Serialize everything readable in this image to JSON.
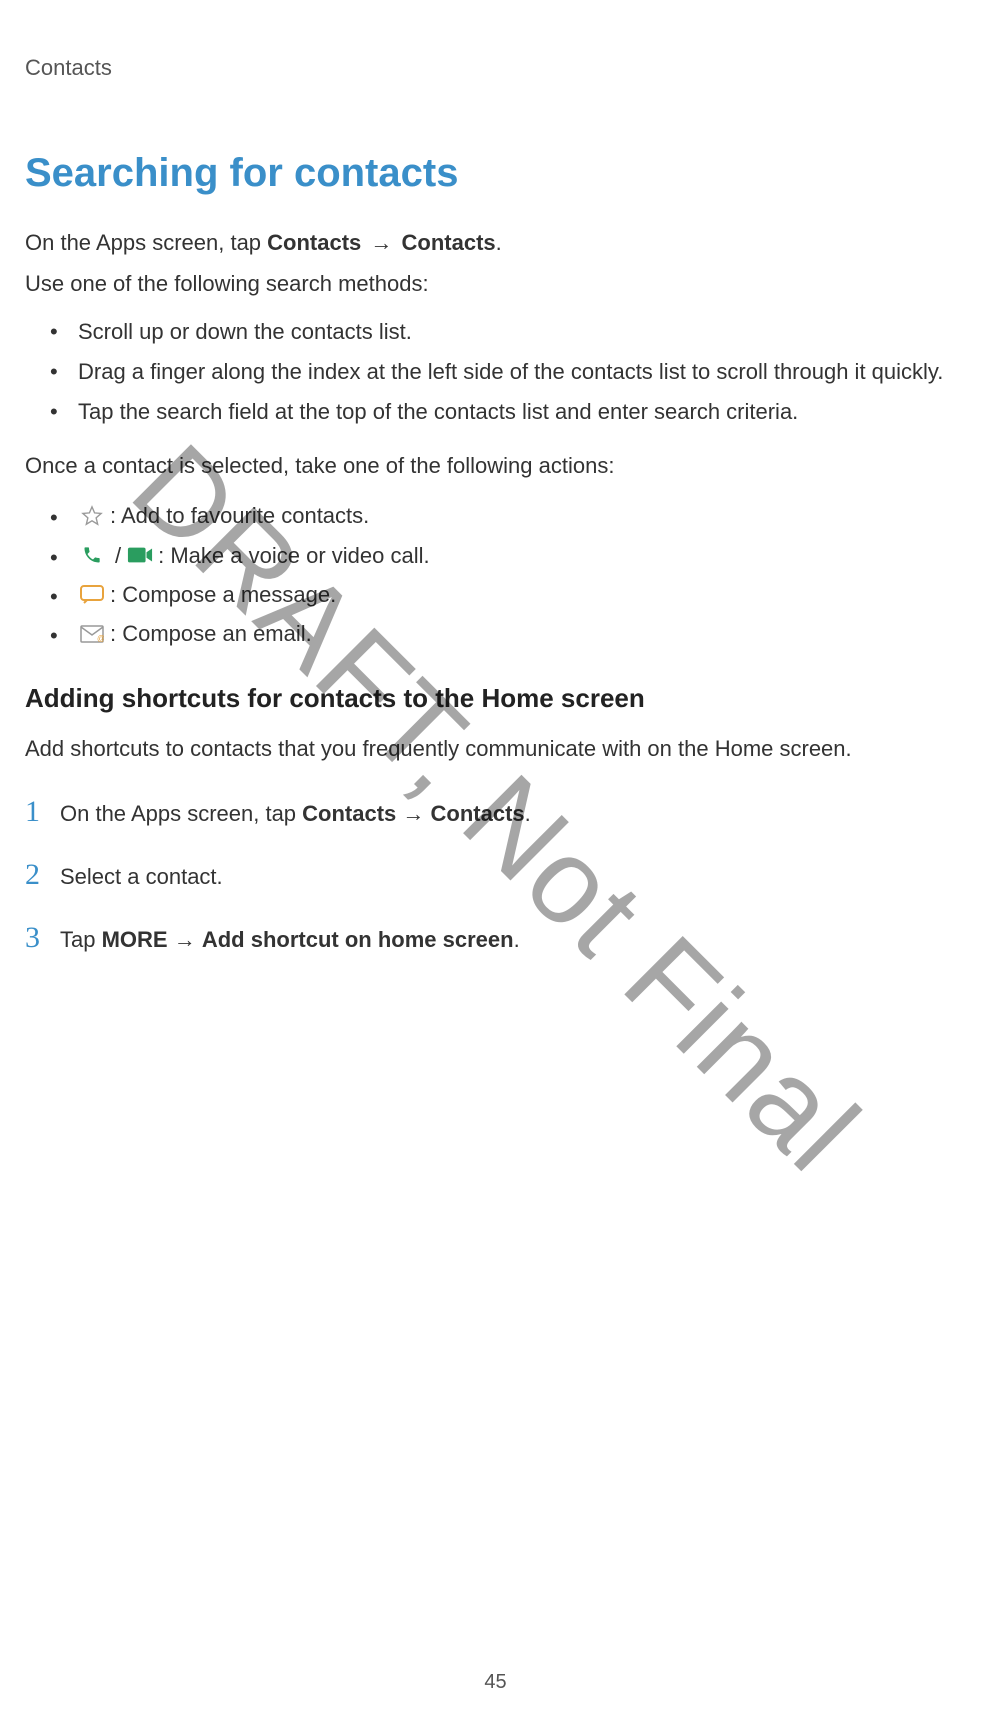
{
  "header": {
    "section": "Contacts"
  },
  "heading": "Searching for contacts",
  "intro1_pre": "On the Apps screen, tap ",
  "intro1_b1": "Contacts",
  "intro1_arrow": "→",
  "intro1_b2": "Contacts",
  "intro1_post": ".",
  "intro2": "Use one of the following search methods:",
  "bullets": [
    "Scroll up or down the contacts list.",
    "Drag a finger along the index at the left side of the contacts list to scroll through it quickly.",
    "Tap the search field at the top of the contacts list and enter search criteria."
  ],
  "intro3": "Once a contact is selected, take one of the following actions:",
  "iconItems": [
    {
      "label": " : Add to favourite contacts."
    },
    {
      "label": " : Make a voice or video call."
    },
    {
      "label": " : Compose a message."
    },
    {
      "label": " : Compose an email."
    }
  ],
  "subHeading": "Adding shortcuts for contacts to the Home screen",
  "subIntro": "Add shortcuts to contacts that you frequently communicate with on the Home screen.",
  "steps": [
    {
      "num": "1",
      "pre": "On the Apps screen, tap ",
      "b1": "Contacts",
      "arrow": "→",
      "b2": "Contacts",
      "post": "."
    },
    {
      "num": "2",
      "pre": "Select a contact.",
      "b1": "",
      "arrow": "",
      "b2": "",
      "post": ""
    },
    {
      "num": "3",
      "pre": "Tap ",
      "b1": "MORE",
      "arrow": "→",
      "b2": "Add shortcut on home screen",
      "post": "."
    }
  ],
  "pageNumber": "45",
  "watermark": "DRAFT, Not Final"
}
